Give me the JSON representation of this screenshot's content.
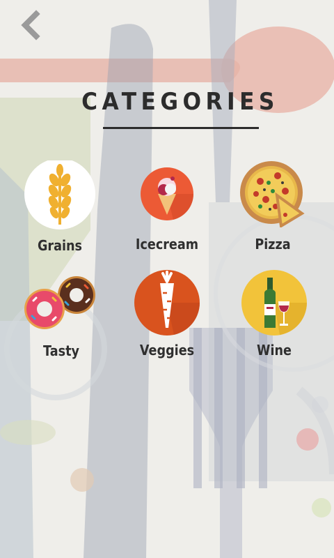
{
  "header": {
    "back_label": "back",
    "title": "CATEGORIES"
  },
  "categories": [
    {
      "label": "Grains",
      "icon": "wheat-icon"
    },
    {
      "label": "Icecream",
      "icon": "icecream-icon"
    },
    {
      "label": "Pizza",
      "icon": "pizza-icon"
    },
    {
      "label": "Tasty",
      "icon": "donuts-icon"
    },
    {
      "label": "Veggies",
      "icon": "carrot-icon"
    },
    {
      "label": "Wine",
      "icon": "wine-icon"
    }
  ],
  "colors": {
    "background": "#efeeea",
    "title": "#2c2c2c",
    "label": "#2f2f2f",
    "back_arrow": "#9a9a9a",
    "icecream_bg": "#ec5a35",
    "carrot_bg": "#d9531e",
    "wine_bg": "#f2c33a"
  }
}
